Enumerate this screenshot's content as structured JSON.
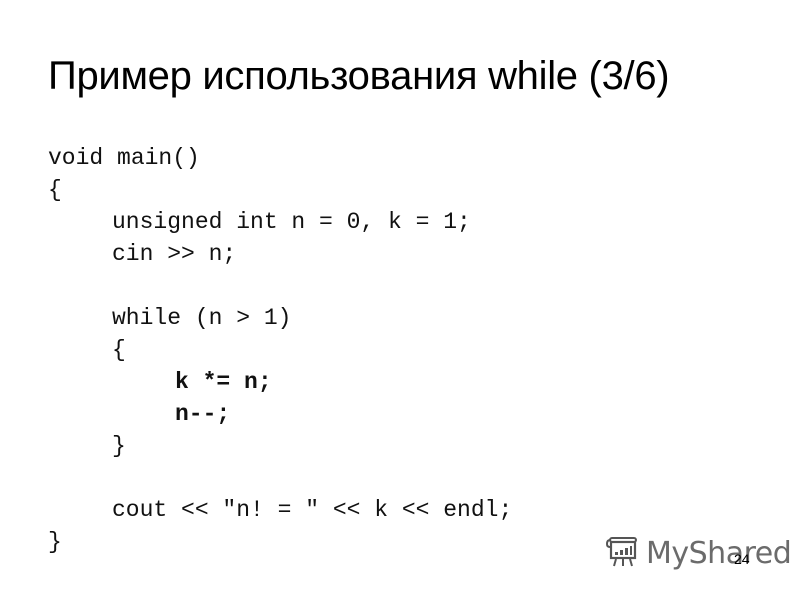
{
  "slide": {
    "title": "Пример использования while (3/6)",
    "code_lines": [
      {
        "text": "void main()",
        "indent": 0,
        "bold": false
      },
      {
        "text": "{",
        "indent": 0,
        "bold": false
      },
      {
        "text": "unsigned int n = 0, k = 1;",
        "indent": 1,
        "bold": false
      },
      {
        "text": "cin >> n;",
        "indent": 1,
        "bold": false
      },
      {
        "text": "",
        "indent": 0,
        "bold": false
      },
      {
        "text": "while (n > 1)",
        "indent": 1,
        "bold": false
      },
      {
        "text": "{",
        "indent": 1,
        "bold": false
      },
      {
        "text": "k *= n;",
        "indent": 2,
        "bold": true
      },
      {
        "text": "n--;",
        "indent": 2,
        "bold": true
      },
      {
        "text": "}",
        "indent": 1,
        "bold": false
      },
      {
        "text": "",
        "indent": 0,
        "bold": false
      },
      {
        "text": "cout << \"n! = \" << k << endl;",
        "indent": 1,
        "bold": false
      },
      {
        "text": "}",
        "indent": 0,
        "bold": false
      }
    ],
    "page_number": "24"
  },
  "watermark": {
    "icon": "presentation-board-icon",
    "brand": "MyShared"
  }
}
